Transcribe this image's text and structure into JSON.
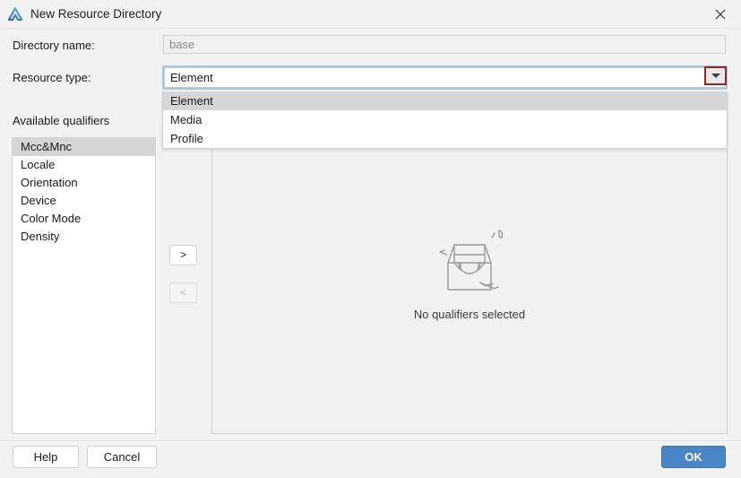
{
  "window": {
    "title": "New Resource Directory",
    "app_icon": "deveco-triangle-icon",
    "close_icon": "close-icon"
  },
  "form": {
    "directory_name_label": "Directory name:",
    "directory_name_value": "base",
    "resource_type_label": "Resource type:",
    "resource_type_value": "Element",
    "dropdown_arrow_icon": "chevron-down-icon"
  },
  "dropdown": {
    "open": true,
    "options": [
      {
        "label": "Element",
        "selected": true
      },
      {
        "label": "Media",
        "selected": false
      },
      {
        "label": "Profile",
        "selected": false
      }
    ]
  },
  "qualifiers": {
    "available_label": "Available qualifiers",
    "items": [
      {
        "label": "Mcc&Mnc",
        "selected": true
      },
      {
        "label": "Locale",
        "selected": false
      },
      {
        "label": "Orientation",
        "selected": false
      },
      {
        "label": "Device",
        "selected": false
      },
      {
        "label": "Color Mode",
        "selected": false
      },
      {
        "label": "Density",
        "selected": false
      }
    ]
  },
  "transfer": {
    "add_label": ">",
    "remove_label": "<"
  },
  "selected_panel": {
    "empty_icon": "empty-box-icon",
    "empty_text": "No qualifiers selected"
  },
  "footer": {
    "help_label": "Help",
    "cancel_label": "Cancel",
    "ok_label": "OK"
  },
  "colors": {
    "dialog_bg": "#f2f2f2",
    "accent_ok": "#4a86c5",
    "focus_ring": "#a7c7e7",
    "highlight_box": "#8e2a2a",
    "selection": "#d6d6d6"
  }
}
